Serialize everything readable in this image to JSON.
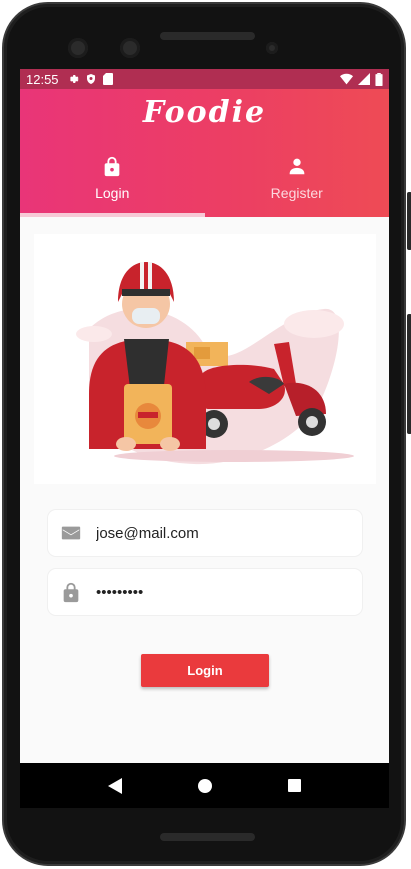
{
  "status_bar": {
    "time": "12:55",
    "icons": [
      "settings-icon",
      "shield-icon",
      "sd-card-icon"
    ],
    "right_icons": [
      "wifi-icon",
      "signal-icon",
      "battery-icon"
    ]
  },
  "app": {
    "title": "Foodie",
    "tabs": [
      {
        "label": "Login",
        "icon": "lock-icon",
        "active": true
      },
      {
        "label": "Register",
        "icon": "person-icon",
        "active": false
      }
    ]
  },
  "hero": {
    "image_description_icon": "delivery-illustration"
  },
  "form": {
    "email_value": "jose@mail.com",
    "password_value": "•••••••••",
    "login_label": "Login"
  },
  "nav": {
    "icons": [
      "back-icon",
      "home-icon",
      "recents-icon"
    ]
  },
  "colors": {
    "accent": "#ea3a3d",
    "appbar_start": "#e93578",
    "appbar_end": "#ee4b55",
    "status_bar": "#b02e52"
  }
}
